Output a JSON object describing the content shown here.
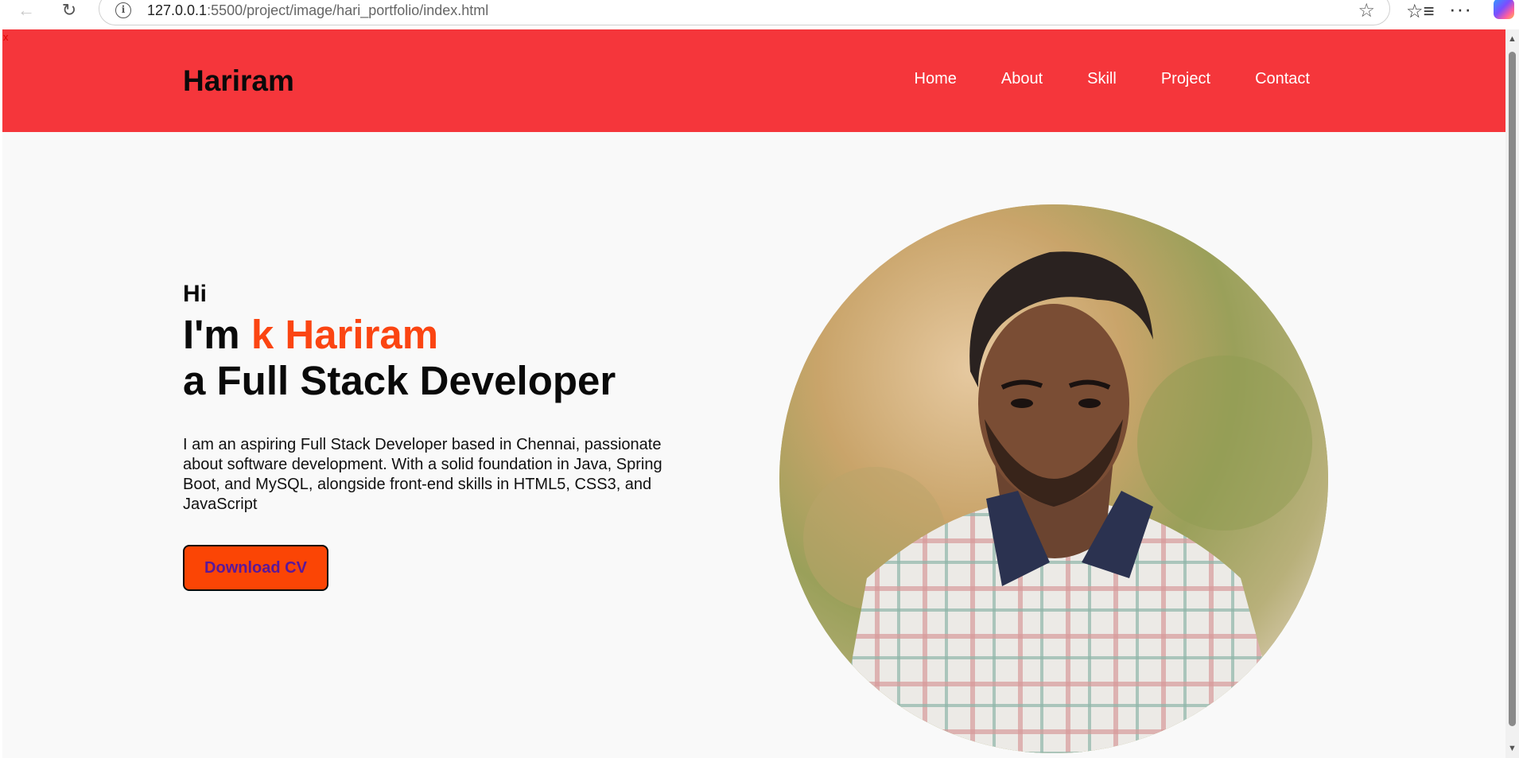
{
  "browser": {
    "url_host": "127.0.0.1",
    "url_path": ":5500/project/image/hari_portfolio/index.html"
  },
  "page": {
    "close_marker": "x",
    "brand": "Hariram",
    "nav": [
      "Home",
      "About",
      "Skill",
      "Project",
      "Contact"
    ],
    "hero": {
      "greeting": "Hi",
      "intro_prefix": "I'm ",
      "intro_name": "k Hariram",
      "role": "a Full Stack Developer",
      "description": "I am an aspiring Full Stack Developer based in Chennai, passionate about software development. With a solid foundation in Java, Spring Boot, and MySQL, alongside front-end skills in HTML5, CSS3, and JavaScript",
      "cta": "Download CV"
    }
  },
  "colors": {
    "navbar": "#f5363b",
    "accent": "#fb4512",
    "button": "#fb4505",
    "button_text": "#5a189a"
  },
  "icons": [
    "back-arrow-icon",
    "reload-icon",
    "site-info-icon",
    "favorite-star-icon",
    "favorites-list-icon",
    "more-menu-icon",
    "copilot-icon"
  ]
}
